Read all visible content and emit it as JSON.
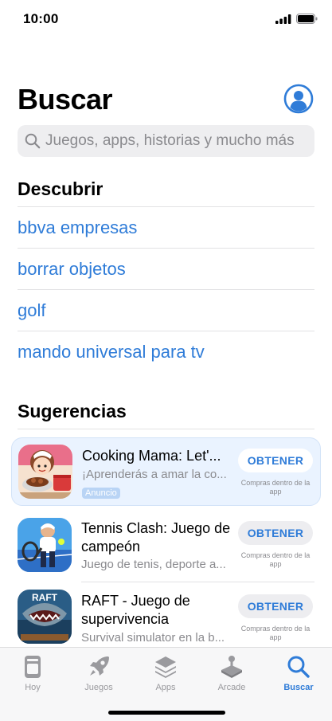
{
  "status_bar": {
    "time": "10:00"
  },
  "header": {
    "title": "Buscar"
  },
  "search": {
    "placeholder": "Juegos, apps, historias y mucho más"
  },
  "discover": {
    "title": "Descubrir",
    "items": [
      "bbva empresas",
      "borrar objetos",
      "golf",
      "mando universal para tv"
    ]
  },
  "suggestions": {
    "title": "Sugerencias",
    "apps": [
      {
        "name": "Cooking Mama: Let'...",
        "subtitle": "¡Aprenderás a amar la co...",
        "badge": "Anuncio",
        "button": "OBTENER",
        "iap": "Compras dentro de la app"
      },
      {
        "name": "Tennis Clash: Juego de campeón",
        "subtitle": "Juego de tenis, deporte a...",
        "button": "OBTENER",
        "iap": "Compras dentro de la app"
      },
      {
        "name": "RAFT - Juego de supervivencia",
        "subtitle": "Survival simulator en la b...",
        "button": "OBTENER",
        "iap": "Compras dentro de la app",
        "icon_text": "RAFT"
      }
    ]
  },
  "tabs": [
    {
      "label": "Hoy",
      "icon": "today-icon"
    },
    {
      "label": "Juegos",
      "icon": "rocket-icon"
    },
    {
      "label": "Apps",
      "icon": "layers-icon"
    },
    {
      "label": "Arcade",
      "icon": "joystick-icon"
    },
    {
      "label": "Buscar",
      "icon": "search-icon",
      "active": true
    }
  ],
  "colors": {
    "accent": "#2f7cd8",
    "ad_background": "#eaf3ff",
    "tab_inactive": "#9a9a9e"
  }
}
